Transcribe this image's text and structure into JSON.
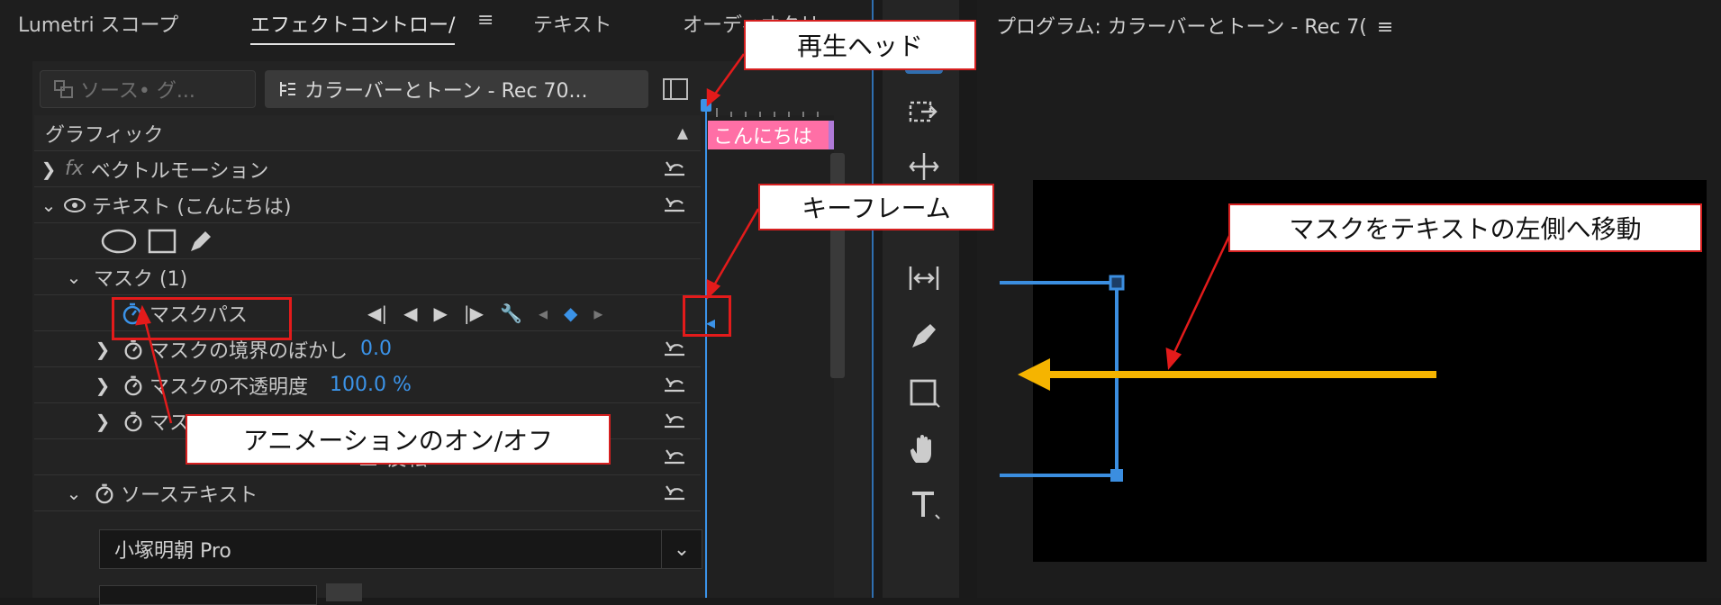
{
  "tabs": [
    "Lumetri スコープ",
    "エフェクトコントロー/",
    "テキスト",
    "オーディオクリ"
  ],
  "tab_menu_glyph": "≡",
  "source_chip": "ソース• グ...",
  "clip_chip": "カラーバーとトーン - Rec 70...",
  "section_header": "グラフィック",
  "clip_label": "こんにちは",
  "rows": {
    "vector_motion": {
      "fx": "fx",
      "label": "ベクトルモーション"
    },
    "text_layer": {
      "label": "テキスト (こんにちは)"
    },
    "mask_group": {
      "label": "マスク (1)"
    },
    "mask_path": {
      "label": "マスクパス"
    },
    "mask_feather": {
      "label": "マスクの境界のぼかし",
      "value": "0.0"
    },
    "mask_opacity": {
      "label": "マスクの不透明度",
      "value": "100.0 %"
    },
    "mask_expansion": {
      "label": "マス"
    },
    "invert": {
      "label": "反転"
    },
    "source_text": {
      "label": "ソーステキスト"
    }
  },
  "font_select": {
    "value": "小塚明朝 Pro"
  },
  "program": {
    "title": "プログラム: カラーバーとトーン - Rec 7(",
    "menu_glyph": "≡"
  },
  "callouts": {
    "playhead": "再生ヘッド",
    "keyframe": "キーフレーム",
    "move_mask": "マスクをテキストの左側へ移動",
    "animation_toggle": "アニメーションのオン/オフ"
  },
  "colors": {
    "accent_blue": "#3b93e8",
    "callout_red": "#d62020",
    "arrow_yellow": "#f5b400",
    "clip_pink": "#ff6fa6"
  }
}
